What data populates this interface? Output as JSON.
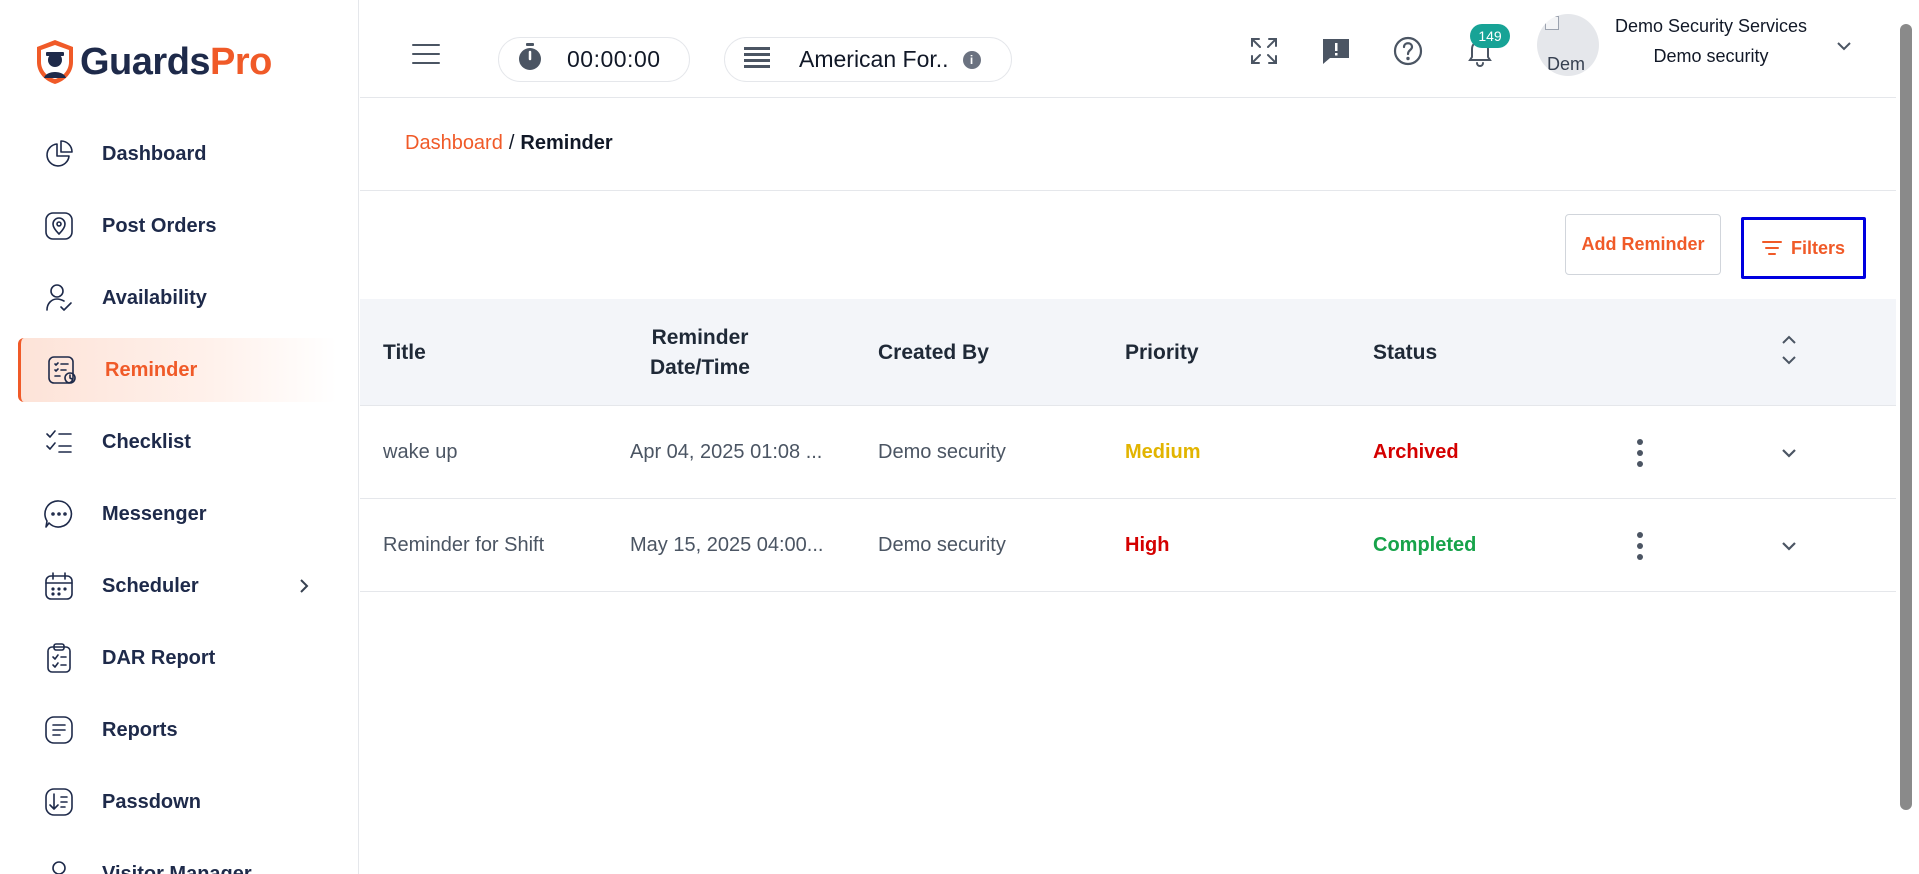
{
  "brand": {
    "part1": "Guards",
    "part2": "Pro"
  },
  "sidebar": {
    "items": [
      {
        "label": "Dashboard",
        "icon": "pie-chart-icon"
      },
      {
        "label": "Post Orders",
        "icon": "map-pin-icon"
      },
      {
        "label": "Availability",
        "icon": "user-check-icon"
      },
      {
        "label": "Reminder",
        "icon": "reminder-list-icon",
        "active": true
      },
      {
        "label": "Checklist",
        "icon": "checklist-icon"
      },
      {
        "label": "Messenger",
        "icon": "chat-icon"
      },
      {
        "label": "Scheduler",
        "icon": "calendar-icon",
        "has_submenu": true
      },
      {
        "label": "DAR Report",
        "icon": "clipboard-icon"
      },
      {
        "label": "Reports",
        "icon": "report-icon"
      },
      {
        "label": "Passdown",
        "icon": "passdown-icon"
      },
      {
        "label": "Visitor Manager",
        "icon": "visitor-icon"
      }
    ]
  },
  "topbar": {
    "timer": "00:00:00",
    "site": "American For..",
    "notifications_count": "149",
    "avatar_alt": "Dem",
    "user_name": "Demo Security Services",
    "user_role": "Demo security"
  },
  "breadcrumb": {
    "home": "Dashboard",
    "separator": "/",
    "current": "Reminder"
  },
  "actions": {
    "add_label": "Add Reminder",
    "filter_label": "Filters"
  },
  "table": {
    "columns": {
      "title": "Title",
      "datetime_l1": "Reminder",
      "datetime_l2": "Date/Time",
      "created_by": "Created By",
      "priority": "Priority",
      "status": "Status"
    },
    "rows": [
      {
        "title": "wake up",
        "datetime": "Apr 04, 2025 01:08 ...",
        "created_by": "Demo security",
        "priority": "Medium",
        "status": "Archived"
      },
      {
        "title": "Reminder for Shift",
        "datetime": "May 15, 2025 04:00...",
        "created_by": "Demo security",
        "priority": "High",
        "status": "Completed"
      }
    ]
  },
  "colors": {
    "accent": "#f05a28",
    "navy": "#1e2a4a",
    "medium": "#e2b400",
    "high": "#d40000",
    "completed": "#17a34a",
    "badge": "#17a396",
    "focus": "#0000e0"
  }
}
